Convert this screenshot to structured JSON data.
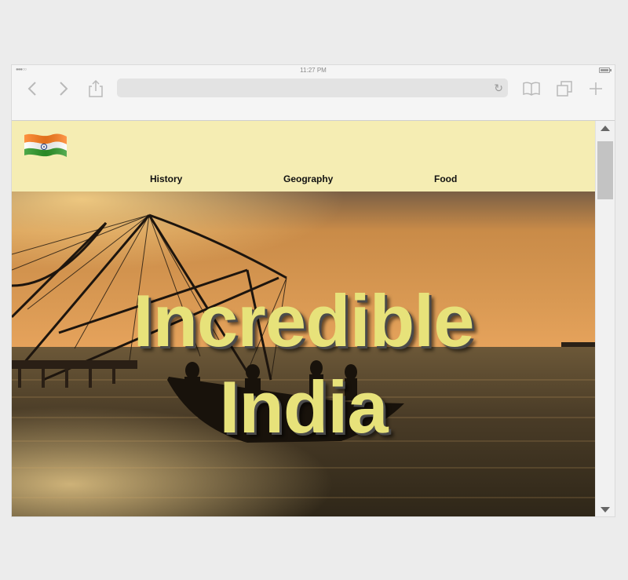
{
  "status_bar": {
    "signal": "●●●○○",
    "time": "11:27 PM"
  },
  "browser": {
    "back_icon": "chevron-left-icon",
    "forward_icon": "chevron-right-icon",
    "share_icon": "share-icon",
    "reload_icon": "reload-icon",
    "reload_glyph": "↻",
    "bookmarks_icon": "book-icon",
    "tabs_icon": "tabs-icon",
    "new_tab_icon": "plus-icon",
    "url": ""
  },
  "site": {
    "logo_icon": "india-flag-icon",
    "nav": [
      {
        "label": "History"
      },
      {
        "label": "Geography"
      },
      {
        "label": "Food"
      }
    ],
    "hero": {
      "line1": "Incredible",
      "line2": "India"
    },
    "colors": {
      "header_bg": "#f5edb3",
      "hero_text": "#e7e27a",
      "flag_saffron": "#ff7f1e",
      "flag_green": "#2f9a2a",
      "flag_chakra": "#1f3c8a"
    }
  }
}
